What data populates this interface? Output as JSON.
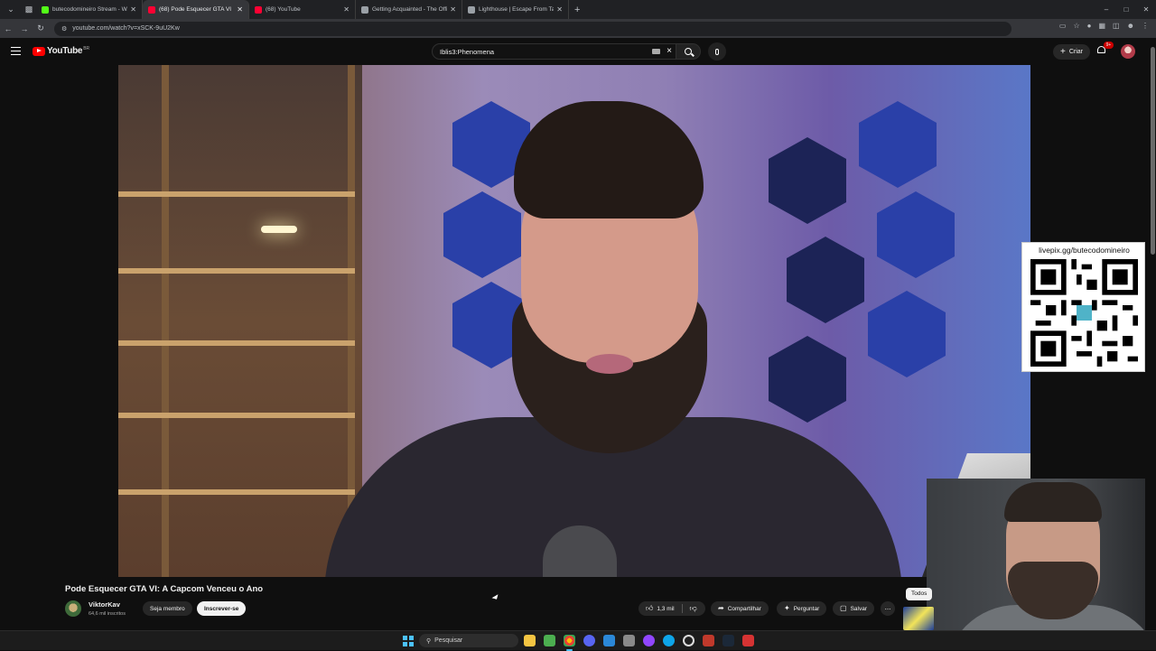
{
  "browser": {
    "tabs": [
      {
        "title": "butecodomineiro Stream - Wa",
        "favicon_color": "#53fc18",
        "active": false
      },
      {
        "title": "(68) Pode Esquecer GTA VI",
        "favicon_color": "#ff0033",
        "active": true
      },
      {
        "title": "(68) YouTube",
        "favicon_color": "#ff0033",
        "active": false
      },
      {
        "title": "Getting Acquainted - The Offic",
        "favicon_color": "#9aa0a6",
        "active": false
      },
      {
        "title": "Lighthouse | Escape From Tark",
        "favicon_color": "#9aa0a6",
        "active": false
      }
    ],
    "url": "youtube.com/watch?v=xSCK-9uU2Kw"
  },
  "youtube": {
    "logo_text": "YouTube",
    "logo_country": "BR",
    "search_value": "Iblis3:Phenomena",
    "create_label": "Criar",
    "notification_count": "9+"
  },
  "overlay": {
    "qr_label": "livepix.gg/butecodomineiro"
  },
  "video": {
    "title": "Pode Esquecer GTA VI: A Capcom Venceu o Ano",
    "channel_name": "ViktorKav",
    "subscribers": "64,6 mil inscritos",
    "join_label": "Seja membro",
    "subscribe_label": "Inscrever-se",
    "likes": "1,3 mil",
    "share_label": "Compartilhar",
    "ask_label": "Perguntar",
    "save_label": "Salvar",
    "more_label": "...",
    "filter_chip": "Todos"
  },
  "taskbar": {
    "search_placeholder": "Pesquisar"
  }
}
